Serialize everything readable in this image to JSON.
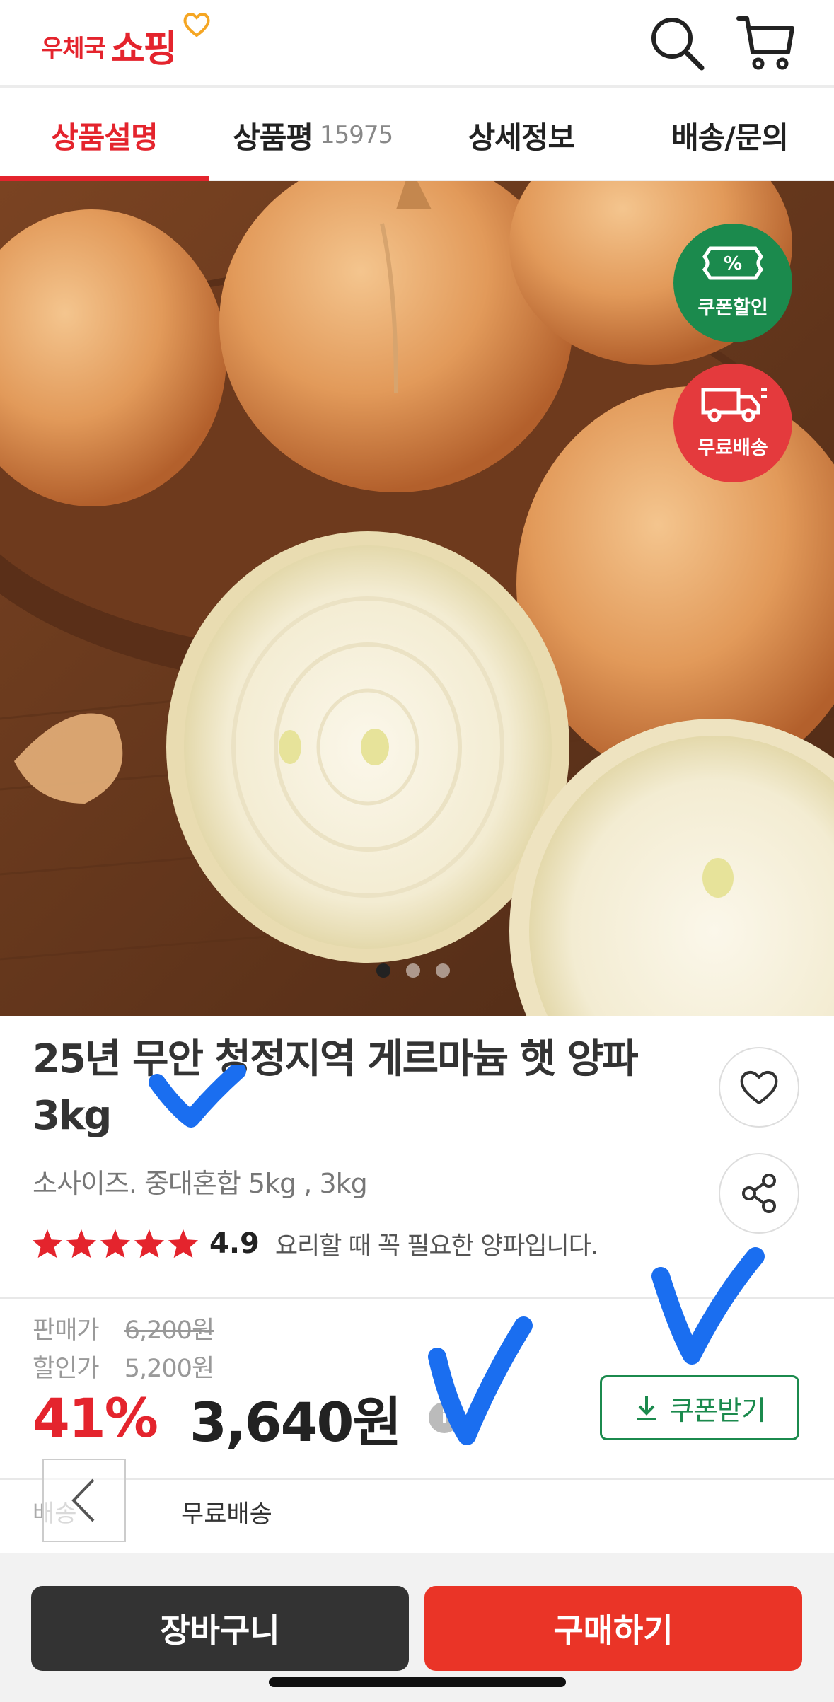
{
  "header": {
    "logo_small": "우체국",
    "logo_big": "쇼핑"
  },
  "tabs": [
    {
      "label": "상품설명",
      "count": "",
      "active": true
    },
    {
      "label": "상품평",
      "count": "15975",
      "active": false
    },
    {
      "label": "상세정보",
      "count": "",
      "active": false
    },
    {
      "label": "배송/문의",
      "count": "",
      "active": false
    }
  ],
  "hero": {
    "badges": {
      "coupon": "쿠폰할인",
      "shipping": "무료배송"
    },
    "carousel": {
      "total": 3,
      "current": 1
    }
  },
  "product": {
    "title_line1": "25년 무안 청정지역 게르마늄 햇 양파",
    "title_line2": "3kg",
    "option": "소사이즈. 중대혼합 5kg , 3kg",
    "rating": "4.9",
    "stars": 5,
    "note": "요리할 때 꼭 필요한 양파입니다."
  },
  "price": {
    "sale_label": "판매가",
    "sale_value": "6,200원",
    "discount_label": "할인가",
    "discount_value": "5,200원",
    "percent": "41%",
    "final": "3,640원",
    "info_glyph": "i",
    "coupon_button": "쿠폰받기"
  },
  "shipping": {
    "label": "배송",
    "value": "무료배송"
  },
  "actions": {
    "cart": "장바구니",
    "buy": "구매하기"
  },
  "colors": {
    "brand_red": "#e4242d",
    "coupon_green": "#1b8a4d",
    "buy_red": "#ea3427",
    "annotation_blue": "#1a6ef0"
  }
}
